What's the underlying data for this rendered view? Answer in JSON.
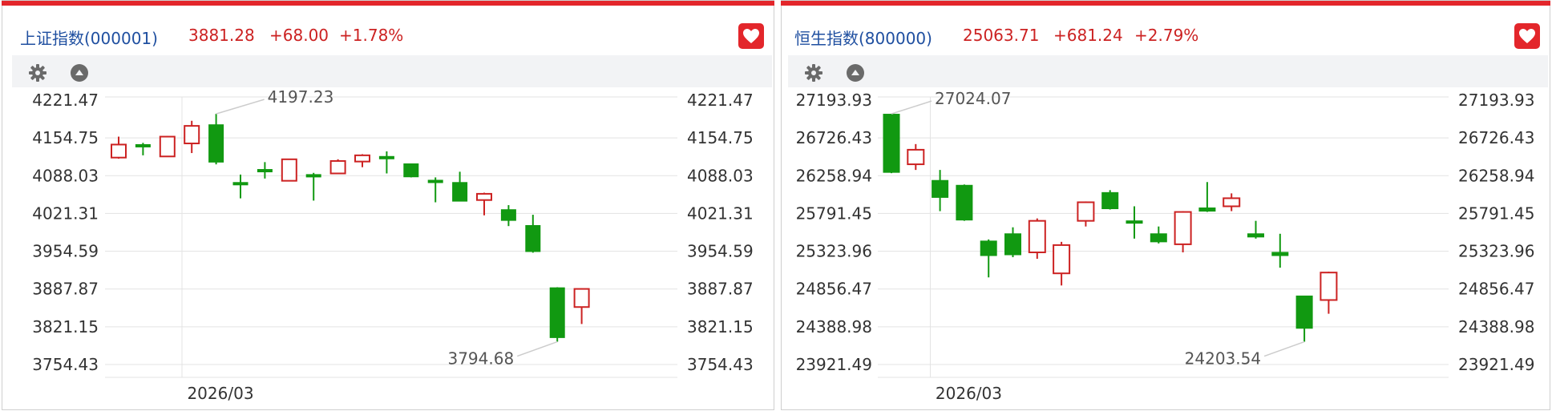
{
  "colors": {
    "up": "#cc2222",
    "down": "#119911",
    "brand": "#e3262b",
    "title": "#1f4fa0",
    "grid": "#e3e3e3",
    "axis_text": "#333333"
  },
  "icons": {
    "favorite": "heart-icon",
    "settings": "gear-icon",
    "collapse": "triangle-up-icon"
  },
  "panels": [
    {
      "title": "上证指数(000001)",
      "price": "3881.28",
      "change": "+68.00",
      "change_pct": "+1.78%",
      "chart_data": {
        "type": "candlestick",
        "x_tick_label": "2026/03",
        "x_tick_index": 3,
        "y_ticks": [
          "4221.47",
          "4154.75",
          "4088.03",
          "4021.31",
          "3954.59",
          "3887.87",
          "3821.15",
          "3754.43"
        ],
        "ylim": [
          3754.43,
          4221.47
        ],
        "high_label": "4197.23",
        "high_index": 4,
        "low_label": "3794.68",
        "low_index": 18,
        "candles": [
          {
            "o": 4120,
            "c": 4143,
            "h": 4157,
            "l": 4118
          },
          {
            "o": 4143,
            "c": 4139,
            "h": 4146,
            "l": 4124
          },
          {
            "o": 4122,
            "c": 4157,
            "h": 4158,
            "l": 4121
          },
          {
            "o": 4145,
            "c": 4176,
            "h": 4185,
            "l": 4128
          },
          {
            "o": 4178,
            "c": 4112,
            "h": 4197.23,
            "l": 4108
          },
          {
            "o": 4076,
            "c": 4073,
            "h": 4090,
            "l": 4048
          },
          {
            "o": 4099,
            "c": 4096,
            "h": 4112,
            "l": 4083
          },
          {
            "o": 4079,
            "c": 4117,
            "h": 4118,
            "l": 4079
          },
          {
            "o": 4090,
            "c": 4088,
            "h": 4093,
            "l": 4044
          },
          {
            "o": 4092,
            "c": 4114,
            "h": 4117,
            "l": 4092
          },
          {
            "o": 4113,
            "c": 4124,
            "h": 4126,
            "l": 4103
          },
          {
            "o": 4122,
            "c": 4120,
            "h": 4131,
            "l": 4092
          },
          {
            "o": 4109,
            "c": 4086,
            "h": 4109,
            "l": 4085
          },
          {
            "o": 4080,
            "c": 4076,
            "h": 4085,
            "l": 4041
          },
          {
            "o": 4076,
            "c": 4043,
            "h": 4095,
            "l": 4043
          },
          {
            "o": 4045,
            "c": 4056,
            "h": 4058,
            "l": 4018
          },
          {
            "o": 4028,
            "c": 4009,
            "h": 4036,
            "l": 3999
          },
          {
            "o": 4000,
            "c": 3954,
            "h": 4019,
            "l": 3952
          },
          {
            "o": 3890,
            "c": 3802,
            "h": 3891,
            "l": 3794.68
          },
          {
            "o": 3856,
            "c": 3888,
            "h": 3889,
            "l": 3826
          }
        ]
      }
    },
    {
      "title": "恒生指数(800000)",
      "price": "25063.71",
      "change": "+681.24",
      "change_pct": "+2.79%",
      "chart_data": {
        "type": "candlestick",
        "x_tick_label": "2026/03",
        "x_tick_index": 2,
        "y_ticks": [
          "27193.93",
          "26726.43",
          "26258.94",
          "25791.45",
          "25323.96",
          "24856.47",
          "24388.98",
          "23921.49"
        ],
        "ylim": [
          23921.49,
          27193.93
        ],
        "high_label": "27024.07",
        "high_index": 0,
        "low_label": "24203.54",
        "low_index": 17,
        "candles": [
          {
            "o": 27020,
            "c": 26300,
            "h": 27024.07,
            "l": 26290
          },
          {
            "o": 26400,
            "c": 26580,
            "h": 26650,
            "l": 26330
          },
          {
            "o": 26200,
            "c": 25990,
            "h": 26330,
            "l": 25820
          },
          {
            "o": 26140,
            "c": 25710,
            "h": 26150,
            "l": 25700
          },
          {
            "o": 25450,
            "c": 25270,
            "h": 25470,
            "l": 25000
          },
          {
            "o": 25540,
            "c": 25280,
            "h": 25620,
            "l": 25250
          },
          {
            "o": 25310,
            "c": 25700,
            "h": 25730,
            "l": 25230
          },
          {
            "o": 25050,
            "c": 25400,
            "h": 25440,
            "l": 24900
          },
          {
            "o": 25700,
            "c": 25930,
            "h": 25940,
            "l": 25630
          },
          {
            "o": 26050,
            "c": 25850,
            "h": 26080,
            "l": 25840
          },
          {
            "o": 25700,
            "c": 25680,
            "h": 25880,
            "l": 25480
          },
          {
            "o": 25540,
            "c": 25440,
            "h": 25630,
            "l": 25420
          },
          {
            "o": 25410,
            "c": 25810,
            "h": 25820,
            "l": 25310
          },
          {
            "o": 25860,
            "c": 25820,
            "h": 26180,
            "l": 25810
          },
          {
            "o": 25880,
            "c": 25980,
            "h": 26040,
            "l": 25820
          },
          {
            "o": 25540,
            "c": 25500,
            "h": 25700,
            "l": 25480
          },
          {
            "o": 25310,
            "c": 25270,
            "h": 25540,
            "l": 25120
          },
          {
            "o": 24770,
            "c": 24370,
            "h": 24770,
            "l": 24203.54
          },
          {
            "o": 24720,
            "c": 25060,
            "h": 25070,
            "l": 24550
          }
        ]
      }
    }
  ]
}
